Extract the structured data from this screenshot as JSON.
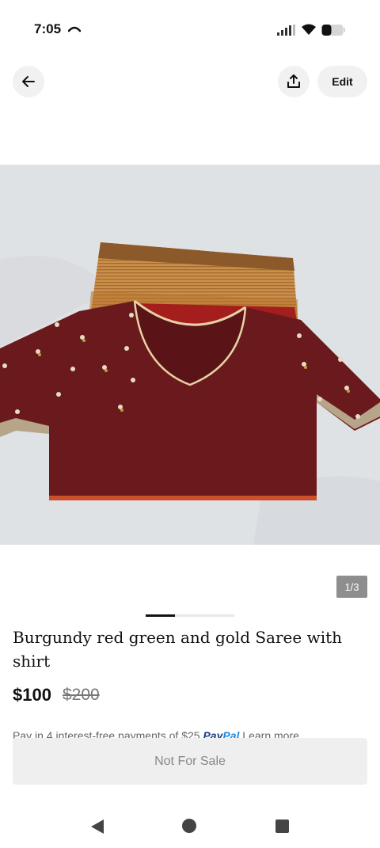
{
  "status_bar": {
    "time": "7:05",
    "icons": [
      "call-icon",
      "signal-icon",
      "wifi-icon",
      "battery-icon"
    ]
  },
  "header": {
    "back_icon": "arrow-left-icon",
    "share_icon": "share-icon",
    "edit_label": "Edit"
  },
  "gallery": {
    "counter": "1/3",
    "current_index": 1,
    "total": 3
  },
  "listing": {
    "title": "Burgundy red green and gold Saree with shirt",
    "price": "$100",
    "original_price": "$200",
    "pay_text": "Pay in 4 interest-free payments of $25",
    "paypal_pay": "Pay",
    "paypal_pal": "Pal",
    "learn_more": "Learn more"
  },
  "action": {
    "label": "Not For Sale"
  },
  "nav": {
    "icons": [
      "nav-back-icon",
      "nav-home-icon",
      "nav-recents-icon"
    ]
  },
  "colors": {
    "accent_paypal": "#1c3d8c",
    "button_bg": "#efefef",
    "blouse": "#6a1a1d",
    "saree_gold": "#c28a3e"
  }
}
